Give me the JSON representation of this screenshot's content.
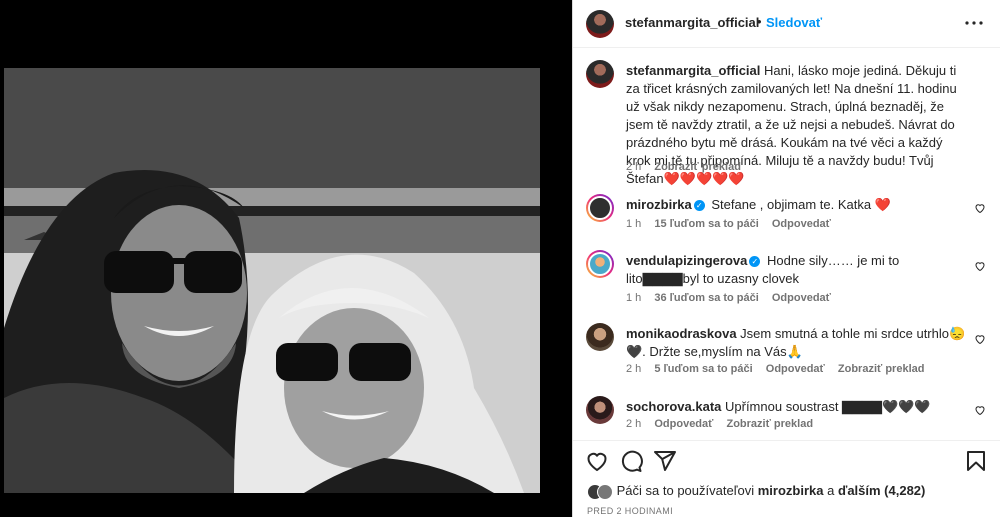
{
  "post": {
    "author": "stefanmargita_official",
    "follow_label": "Sledovať",
    "dot": "•",
    "caption": "Hani, lásko moje jediná. Děkuju ti za třicet krásných zamilovaných let! Na dnešní 11. hodinu už však nikdy nezapomenu. Strach, úplná beznaděj, že jsem tě navždy ztratil, a že už nejsi a nebudeš. Návrat do prázdného bytu mě drásá. Koukám na tvé věci a každý krok mi tě tu připomíná. Miluju tě a navždy budu! Tvůj Štefan",
    "caption_hearts": "❤️❤️❤️❤️❤️",
    "caption_time": "2 h",
    "caption_translate": "Zobraziť preklad"
  },
  "comments": [
    {
      "user": "mirozbirka",
      "verified": true,
      "text": "Stefane , objimam te. Katka ❤️",
      "time": "1 h",
      "likes": "15 ľuďom sa to páči",
      "reply": "Odpovedať",
      "translate": ""
    },
    {
      "user": "vendulapizingerova",
      "verified": true,
      "text": "Hodne sily…… je mi to lito▇▇▇▇byl to uzasny clovek",
      "time": "1 h",
      "likes": "36 ľuďom sa to páči",
      "reply": "Odpovedať",
      "translate": ""
    },
    {
      "user": "monikaodraskova",
      "verified": false,
      "text": "Jsem smutná a tohle mi srdce utrhlo😓🖤. Držte se,myslím na Vás🙏",
      "time": "2 h",
      "likes": "5 ľuďom sa to páči",
      "reply": "Odpovedať",
      "translate": "Zobraziť preklad"
    },
    {
      "user": "sochorova.kata",
      "verified": false,
      "text": "Upřímnou soustrast ▇▇▇▇🖤🖤🖤",
      "time": "2 h",
      "likes": "",
      "reply": "Odpovedať",
      "translate": "Zobraziť preklad"
    }
  ],
  "likes_bar": {
    "prefix": "Páči sa to používateľovi",
    "user": "mirozbirka",
    "middle": "a",
    "others": "ďalším (4,282)"
  },
  "timestamp": "PRED 2 HODINAMI",
  "icons": [
    "more-icon",
    "heart-icon",
    "comment-icon",
    "share-icon",
    "bookmark-icon",
    "verified-icon"
  ],
  "colors": {
    "accent": "#0095f6",
    "text": "#262626",
    "secondary": "#737373",
    "heart": "#ed1b3c"
  }
}
